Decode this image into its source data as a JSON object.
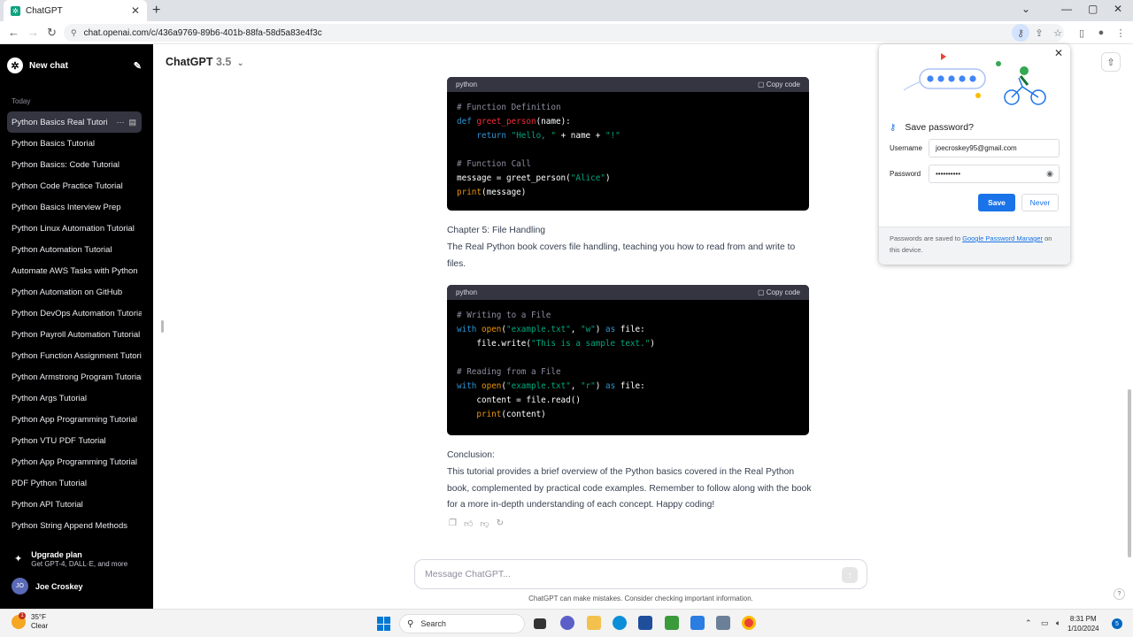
{
  "browser": {
    "tab_title": "ChatGPT",
    "url": "chat.openai.com/c/436a9769-89b6-401b-88fa-58d5a83e4f3c"
  },
  "sidebar": {
    "new_chat": "New chat",
    "section_today": "Today",
    "items": [
      "Python Basics Real Tutorial",
      "Python Basics Tutorial",
      "Python Basics: Code Tutorial",
      "Python Code Practice Tutorial",
      "Python Basics Interview Prep",
      "Python Linux Automation Tutorial",
      "Python Automation Tutorial",
      "Automate AWS Tasks with Python",
      "Python Automation on GitHub",
      "Python DevOps Automation Tutorial",
      "Python Payroll Automation Tutorial",
      "Python Function Assignment Tutorial",
      "Python Armstrong Program Tutorial",
      "Python Args Tutorial",
      "Python App Programming Tutorial",
      "Python VTU PDF Tutorial",
      "Python App Programming Tutorial",
      "PDF Python Tutorial",
      "Python API Tutorial",
      "Python String Append Methods"
    ],
    "upgrade_title": "Upgrade plan",
    "upgrade_sub": "Get GPT-4, DALL·E, and more",
    "user_initials": "JO",
    "user_name": "Joe Croskey"
  },
  "header": {
    "model": "ChatGPT",
    "version": "3.5"
  },
  "content": {
    "code1_lang": "python",
    "copy_label": "Copy code",
    "chapter5_title": "Chapter 5: File Handling",
    "chapter5_text": "The Real Python book covers file handling, teaching you how to read from and write to files.",
    "code2_lang": "python",
    "conclusion_title": "Conclusion:",
    "conclusion_text": "This tutorial provides a brief overview of the Python basics covered in the Real Python book, complemented by practical code examples. Remember to follow along with the book for a more in-depth understanding of each concept. Happy coding!"
  },
  "composer": {
    "placeholder": "Message ChatGPT...",
    "disclaimer": "ChatGPT can make mistakes. Consider checking important information."
  },
  "password_popup": {
    "title": "Save password?",
    "username_label": "Username",
    "username_value": "joecroskey95@gmail.com",
    "password_label": "Password",
    "password_value": "••••••••••",
    "save_label": "Save",
    "never_label": "Never",
    "footer_prefix": "Passwords are saved to ",
    "footer_link": "Google Password Manager",
    "footer_suffix": " on this device."
  },
  "taskbar": {
    "temp": "35°F",
    "condition": "Clear",
    "weather_badge": "1",
    "search": "Search",
    "time": "8:31 PM",
    "date": "1/10/2024",
    "notifications": "5"
  }
}
